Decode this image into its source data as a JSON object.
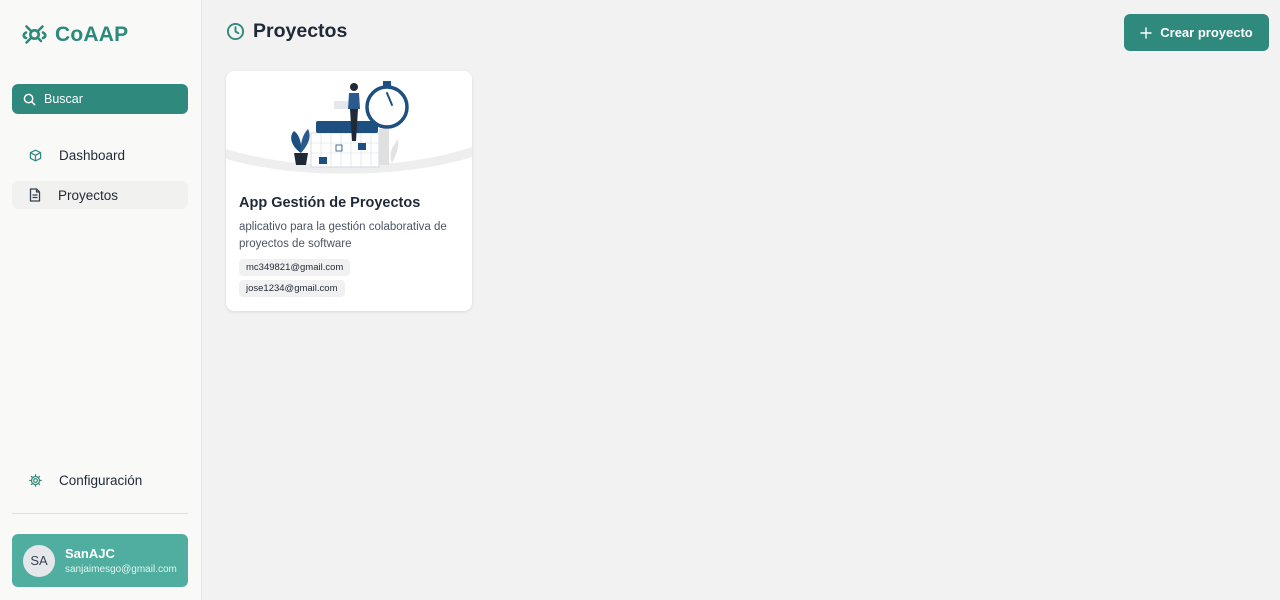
{
  "app": {
    "name": "CoAAP"
  },
  "sidebar": {
    "search_label": "Buscar",
    "items": [
      {
        "label": "Dashboard",
        "icon": "cube-icon"
      },
      {
        "label": "Proyectos",
        "icon": "document-icon",
        "active": true
      }
    ],
    "settings_label": "Configuración",
    "user": {
      "initials": "SA",
      "name": "SanAJC",
      "email": "sanjaimesgo@gmail.com"
    }
  },
  "main": {
    "title": "Proyectos",
    "title_icon": "clock-icon",
    "create_button_label": "Crear proyecto",
    "projects": [
      {
        "title": "App Gestión de Proyectos",
        "description": "aplicativo para la gestión colaborativa de proyectos de software",
        "members": [
          "mc349821@gmail.com",
          "jose1234@gmail.com"
        ]
      }
    ]
  },
  "colors": {
    "accent": "#2f8a7d",
    "accent_light": "#4fae9f",
    "background": "#f2f2f2",
    "sidebar": "#f9f9f8"
  }
}
